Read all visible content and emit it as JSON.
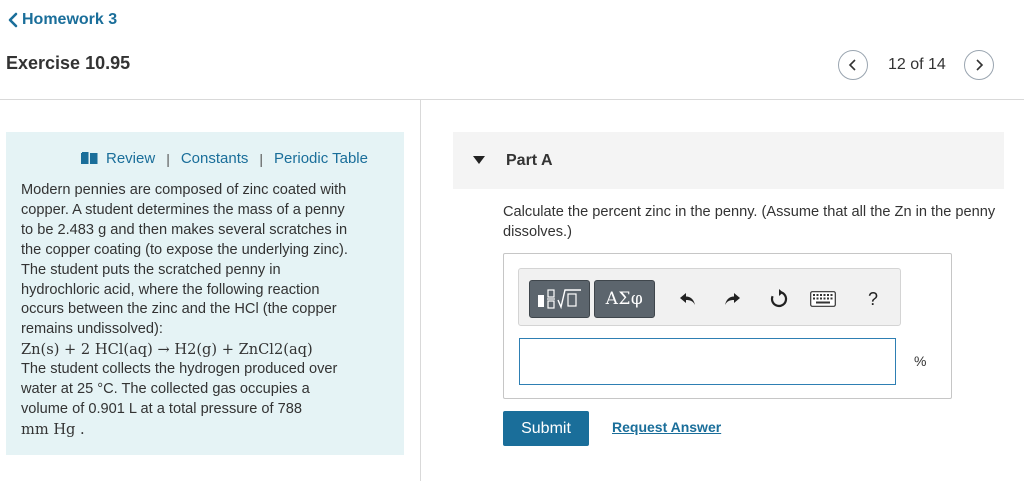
{
  "header": {
    "back_label": "Homework 3",
    "exercise_title": "Exercise 10.95",
    "pager_text": "12 of 14"
  },
  "info_panel": {
    "tabs": [
      "Review",
      "Constants",
      "Periodic Table"
    ],
    "separator": "|",
    "lines": [
      "Modern pennies are composed of zinc coated with",
      "copper. A student determines the mass of a penny",
      "to be 2.483 g and then makes several scratches in",
      "the copper coating (to expose the underlying zinc).",
      "The student puts the scratched penny in",
      "hydrochloric acid, where the following reaction",
      "occurs between the zinc and the HCl (the copper",
      "remains undissolved):",
      "Zn(s) + 2 HCl(aq) → H2(g) + ZnCl2(aq)",
      "The student collects the hydrogen produced over",
      "water at 25 °C. The collected gas occupies a",
      "volume of 0.901 L at a total pressure of 788",
      "mm Hg ."
    ]
  },
  "part": {
    "label": "Part A",
    "question": "Calculate the percent zinc in the penny. (Assume that all the Zn in the penny dissolves.)"
  },
  "toolbar": {
    "template_icon": "fraction-sqrt-icon",
    "greek_label": "ΑΣφ",
    "undo_icon": "undo-icon",
    "redo_icon": "redo-icon",
    "reset_icon": "reset-icon",
    "keyboard_icon": "keyboard-icon",
    "help_label": "?"
  },
  "answer": {
    "value": "",
    "unit": "%"
  },
  "actions": {
    "submit_label": "Submit",
    "request_label": "Request Answer"
  },
  "colors": {
    "accent": "#1a6e9a",
    "info_panel_bg": "#e5f3f5",
    "part_header_bg": "#f4f4f4",
    "toolbar_button": "#5c656d"
  }
}
